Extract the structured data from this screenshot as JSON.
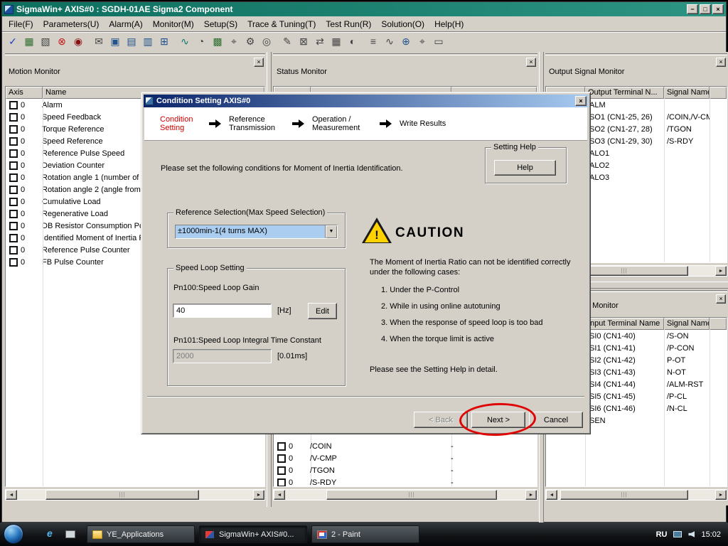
{
  "window": {
    "title": "SigmaWin+ AXIS#0 : SGDH-01AE Sigma2 Component",
    "minimize": "−",
    "restore": "□",
    "close": "×"
  },
  "menubar": {
    "items": [
      "File(F)",
      "Parameters(U)",
      "Alarm(A)",
      "Monitor(M)",
      "Setup(S)",
      "Trace & Tuning(T)",
      "Test Run(R)",
      "Solution(O)",
      "Help(H)"
    ]
  },
  "toolbar": {
    "icons": [
      {
        "name": "verify-icon",
        "glyph": "✓"
      },
      {
        "name": "parameter-edit-icon",
        "glyph": "▦"
      },
      {
        "name": "trace-icon",
        "glyph": "▧"
      },
      {
        "name": "alarm-display-icon",
        "glyph": "⊗"
      },
      {
        "name": "alarm-traceback-icon",
        "glyph": "◉"
      },
      {
        "name": "report-icon",
        "glyph": "✉"
      },
      {
        "name": "system-monitor-icon",
        "glyph": "▣"
      },
      {
        "name": "motion-monitor-icon",
        "glyph": "▤"
      },
      {
        "name": "status-monitor-icon",
        "glyph": "▥"
      },
      {
        "name": "io-monitor-icon",
        "glyph": "⊞"
      },
      {
        "name": "waveform-icon",
        "glyph": "∿"
      },
      {
        "name": "gauge-icon",
        "glyph": "◔"
      },
      {
        "name": "plc-icon",
        "glyph": "▩"
      },
      {
        "name": "locate-icon",
        "glyph": "⌖"
      },
      {
        "name": "gear-icon",
        "glyph": "⚙"
      },
      {
        "name": "scope-icon",
        "glyph": "◎"
      },
      {
        "name": "tuning-icon",
        "glyph": "✎"
      },
      {
        "name": "mail-icon",
        "glyph": "⊠"
      },
      {
        "name": "transfer-icon",
        "glyph": "⇄"
      },
      {
        "name": "table-icon",
        "glyph": "▦"
      },
      {
        "name": "meter-icon",
        "glyph": "◐"
      },
      {
        "name": "menu-icon",
        "glyph": "≡"
      },
      {
        "name": "wave-icon",
        "glyph": "∿"
      },
      {
        "name": "zoom-icon",
        "glyph": "⊕"
      },
      {
        "name": "crosshair-icon",
        "glyph": "⌖"
      },
      {
        "name": "screen-icon",
        "glyph": "▭"
      }
    ]
  },
  "panels": {
    "close_glyph": "×",
    "scroll_left": "◄",
    "scroll_right": "►",
    "motion_monitor": {
      "title": "Motion Monitor",
      "columns": [
        "Axis",
        "Name"
      ],
      "rows": [
        {
          "axis": "0",
          "name": "Alarm"
        },
        {
          "axis": "0",
          "name": "Speed Feedback"
        },
        {
          "axis": "0",
          "name": "Torque Reference"
        },
        {
          "axis": "0",
          "name": "Speed Reference"
        },
        {
          "axis": "0",
          "name": "Reference Pulse Speed"
        },
        {
          "axis": "0",
          "name": "Deviation Counter"
        },
        {
          "axis": "0",
          "name": "Rotation angle 1 (number of"
        },
        {
          "axis": "0",
          "name": "Rotation angle 2 (angle from"
        },
        {
          "axis": "0",
          "name": "Cumulative Load"
        },
        {
          "axis": "0",
          "name": "Regenerative Load"
        },
        {
          "axis": "0",
          "name": "DB Resistor Consumption Po"
        },
        {
          "axis": "0",
          "name": "Identified Moment of Inertia R"
        },
        {
          "axis": "0",
          "name": "Reference Pulse Counter"
        },
        {
          "axis": "0",
          "name": "FB Pulse Counter"
        }
      ]
    },
    "status_monitor": {
      "title": "Status Monitor",
      "rows": [
        {
          "axis": "0",
          "name": "/COIN",
          "value": "-"
        },
        {
          "axis": "0",
          "name": "/V-CMP",
          "value": "-"
        },
        {
          "axis": "0",
          "name": "/TGON",
          "value": "-"
        },
        {
          "axis": "0",
          "name": "/S-RDY",
          "value": "-"
        }
      ]
    },
    "output_signal_monitor": {
      "title": "Output Signal Monitor",
      "columns": [
        "Output Terminal N...",
        "Signal Name"
      ],
      "rows": [
        {
          "terminal": "ALM",
          "signal": ""
        },
        {
          "terminal": "SO1 (CN1-25, 26)",
          "signal": "/COIN,/V-CMP"
        },
        {
          "terminal": "SO2 (CN1-27, 28)",
          "signal": "/TGON"
        },
        {
          "terminal": "SO3 (CN1-29, 30)",
          "signal": "/S-RDY"
        },
        {
          "terminal": "ALO1",
          "signal": ""
        },
        {
          "terminal": "ALO2",
          "signal": ""
        },
        {
          "terminal": "ALO3",
          "signal": ""
        }
      ]
    },
    "input_signal_monitor": {
      "title": "Input Signal Monitor",
      "columns": [
        "Input Terminal Name",
        "Signal Name"
      ],
      "rows": [
        {
          "terminal": "SI0 (CN1-40)",
          "signal": "/S-ON"
        },
        {
          "terminal": "SI1 (CN1-41)",
          "signal": "/P-CON"
        },
        {
          "terminal": "SI2 (CN1-42)",
          "signal": "P-OT"
        },
        {
          "terminal": "SI3 (CN1-43)",
          "signal": "N-OT"
        },
        {
          "terminal": "SI4 (CN1-44)",
          "signal": "/ALM-RST"
        },
        {
          "terminal": "SI5 (CN1-45)",
          "signal": "/P-CL"
        },
        {
          "terminal": "SI6 (CN1-46)",
          "signal": "/N-CL"
        },
        {
          "terminal": "SEN",
          "signal": ""
        }
      ]
    }
  },
  "dialog": {
    "title": "Condition Setting AXIS#0",
    "close": "×",
    "steps": [
      {
        "label": "Condition Setting"
      },
      {
        "label": "Reference Transmission"
      },
      {
        "label": "Operation / Measurement"
      },
      {
        "label": "Write Results"
      }
    ],
    "intro": "Please set the following conditions for Moment of Inertia Identification.",
    "setting_help_group": "Setting Help",
    "help_button": "Help",
    "reference_group": "Reference Selection(Max Speed Selection)",
    "reference_value": "±1000min-1(4 turns MAX)",
    "combo_arrow": "▼",
    "speed_group": "Speed Loop Setting",
    "pn100_label": "Pn100:Speed Loop Gain",
    "pn100_value": "40",
    "pn100_unit": "[Hz]",
    "edit_button": "Edit",
    "pn101_label": "Pn101:Speed Loop Integral Time Constant",
    "pn101_value": "2000",
    "pn101_unit": "[0.01ms]",
    "caution_title": "CAUTION",
    "caution_mark": "!",
    "caution_intro": "The Moment of Inertia Ratio can not be identified correctly under the following cases:",
    "caution_items": [
      "1. Under the P-Control",
      "2. While in using online autotuning",
      "3. When the response of speed loop is too bad",
      "4. When the torque limit is active"
    ],
    "caution_footer": "Please see the Setting Help in detail.",
    "back_button": "< Back",
    "next_button": "Next >",
    "cancel_button": "Cancel"
  },
  "taskbar": {
    "quicklaunch_ie": "e",
    "tasks": [
      {
        "label": "YE_Applications"
      },
      {
        "label": "SigmaWin+ AXIS#0..."
      },
      {
        "label": "2 - Paint"
      }
    ],
    "tray": {
      "lang": "RU",
      "time": "15:02"
    }
  }
}
